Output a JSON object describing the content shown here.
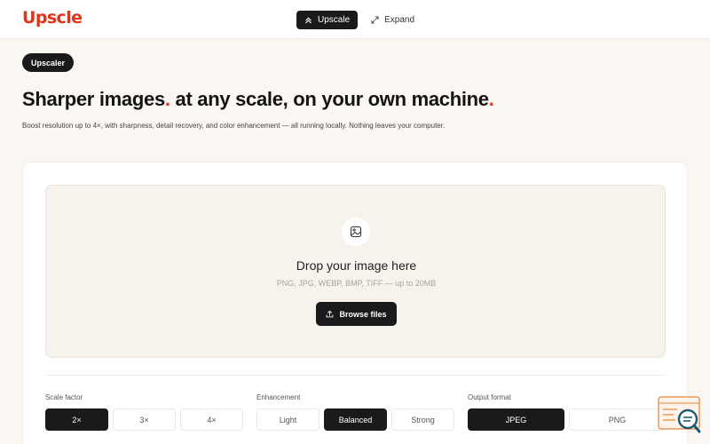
{
  "header": {
    "logo": "Upscle",
    "nav": [
      {
        "label": "Upscale",
        "icon": "chevrons-up-icon",
        "active": true
      },
      {
        "label": "Expand",
        "icon": "expand-arrows-icon",
        "active": false
      }
    ]
  },
  "hero": {
    "badge": "Upscaler",
    "headline_part1": "Sharper images",
    "headline_part2": " at any scale, on your own machine",
    "accent_dot": ".",
    "subtitle": "Boost resolution up to 4×, with sharpness, detail recovery, and color enhancement — all running locally. Nothing leaves your computer."
  },
  "dropzone": {
    "icon": "image-icon",
    "title": "Drop your image here",
    "formats": "PNG, JPG, WEBP, BMP, TIFF — up to 20MB",
    "browse_label": "Browse files",
    "browse_icon": "upload-icon"
  },
  "options": {
    "scale": {
      "label": "Scale factor",
      "items": [
        "2×",
        "3×",
        "4×"
      ],
      "selected": "2×"
    },
    "enhancement": {
      "label": "Enhancement",
      "items": [
        "Light",
        "Balanced",
        "Strong"
      ],
      "selected": "Balanced"
    },
    "format": {
      "label": "Output format",
      "items": [
        "JPEG",
        "PNG"
      ],
      "selected": "JPEG"
    }
  },
  "colors": {
    "accent": "#e0341c",
    "dark": "#1a1a1a",
    "background": "#faf7f2"
  }
}
